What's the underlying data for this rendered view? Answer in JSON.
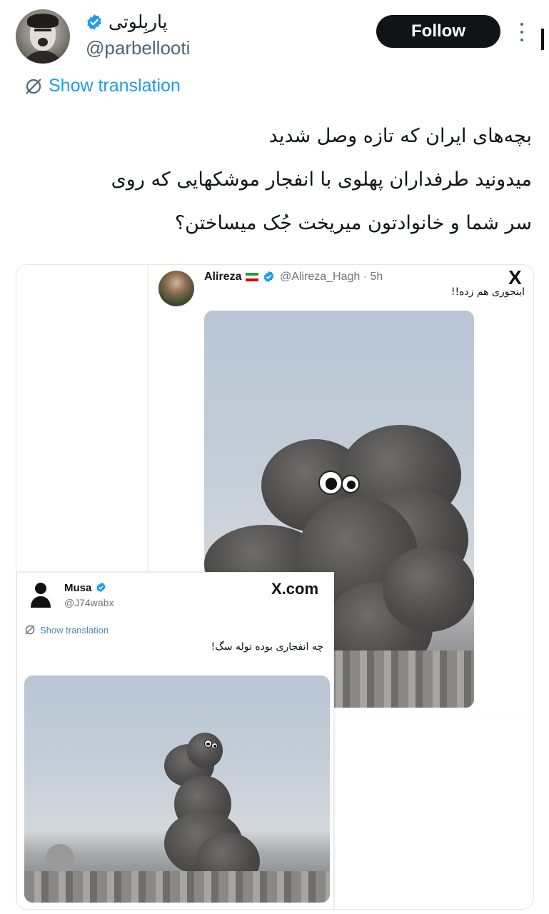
{
  "author": {
    "display_name": "پاربِلوتی",
    "handle": "@parbellooti",
    "verified": true
  },
  "actions": {
    "follow_label": "Follow",
    "more_icon": "more-vertical-icon"
  },
  "translation": {
    "label": "Show translation",
    "icon": "translate-icon"
  },
  "tweet": {
    "lines": [
      "بچه‌های ایران که تازه وصل شدید",
      "میدونید طرفداران پهلوی با انفجار موشکهایی که روی",
      "سر شما و خانوادتون میریخت جُک میساختن؟"
    ]
  },
  "embedded_tweets": {
    "alireza": {
      "name": "Alireza",
      "handle_time": "@Alireza_Hagh · 5h",
      "text": "اینجوری هم زده!!",
      "x_logo": "X"
    },
    "musa": {
      "name": "Musa",
      "handle": "@J74wabx",
      "x_logo": "X.com",
      "translate_label": "Show translation",
      "text": "چه انفجاری بوده توله سگ!"
    }
  },
  "colors": {
    "accent": "#1d9bf0",
    "follow_bg": "#0f1419",
    "secondary_text": "#536471"
  }
}
